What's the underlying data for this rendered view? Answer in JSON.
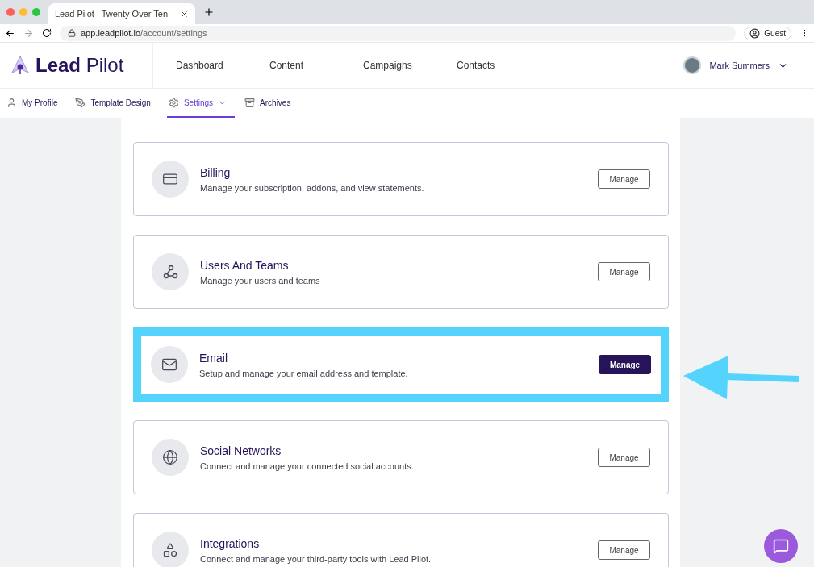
{
  "browser": {
    "tab_title": "Lead Pilot | Twenty Over Ten",
    "url_host": "app.leadpilot.io",
    "url_path": "/account/settings",
    "profile": "Guest"
  },
  "header": {
    "logo_bold": "Lead",
    "logo_light": "Pilot",
    "nav": [
      "Dashboard",
      "Content",
      "Campaigns",
      "Contacts"
    ],
    "user": "Mark Summers"
  },
  "subnav": [
    {
      "label": "My Profile",
      "kind": "user",
      "selected": false,
      "dropdown": false
    },
    {
      "label": "Template Design",
      "kind": "brush",
      "selected": false,
      "dropdown": false
    },
    {
      "label": "Settings",
      "kind": "gear",
      "selected": true,
      "dropdown": true
    },
    {
      "label": "Archives",
      "kind": "archive",
      "selected": false,
      "dropdown": false
    }
  ],
  "cards": [
    {
      "kind": "card",
      "title": "Billing",
      "description": "Manage your subscription, addons, and view statements.",
      "button": "Manage",
      "highlighted": false
    },
    {
      "kind": "nodes",
      "title": "Users And Teams",
      "description": "Manage your users and teams",
      "button": "Manage",
      "highlighted": false
    },
    {
      "kind": "mail",
      "title": "Email",
      "description": "Setup and manage your email address and template.",
      "button": "Manage",
      "highlighted": true
    },
    {
      "kind": "globe",
      "title": "Social Networks",
      "description": "Connect and manage your connected social accounts.",
      "button": "Manage",
      "highlighted": false
    },
    {
      "kind": "shapes",
      "title": "Integrations",
      "description": "Connect and manage your third-party tools with Lead Pilot.",
      "button": "Manage",
      "highlighted": false
    }
  ]
}
